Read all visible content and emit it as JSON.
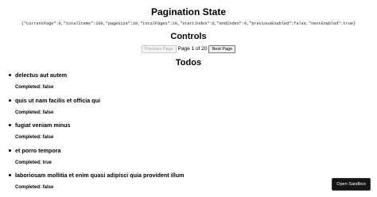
{
  "state": {
    "title": "Pagination State",
    "json": "{\"currentPage\":0,\"totalItems\":200,\"pageSize\":10,\"totalPages\":20,\"startIndex\":0,\"endIndex\":9,\"previousEnabled\":false,\"nextEnabled\":true}"
  },
  "controls": {
    "title": "Controls",
    "previous_label": "Previous Page",
    "page_text": "Page 1 of 20",
    "next_label": "Next Page"
  },
  "todos": {
    "title": "Todos",
    "items": [
      {
        "title": "delectus aut autem",
        "status": "Completed: false"
      },
      {
        "title": "quis ut nam facilis et officia qui",
        "status": "Completed: false"
      },
      {
        "title": "fugiat veniam minus",
        "status": "Completed: false"
      },
      {
        "title": "et porro tempora",
        "status": "Completed: true"
      },
      {
        "title": "laboriosam mollitia et enim quasi adipisci quia provident illum",
        "status": "Completed: false"
      }
    ]
  },
  "sandbox": {
    "label": "Open Sandbox"
  }
}
